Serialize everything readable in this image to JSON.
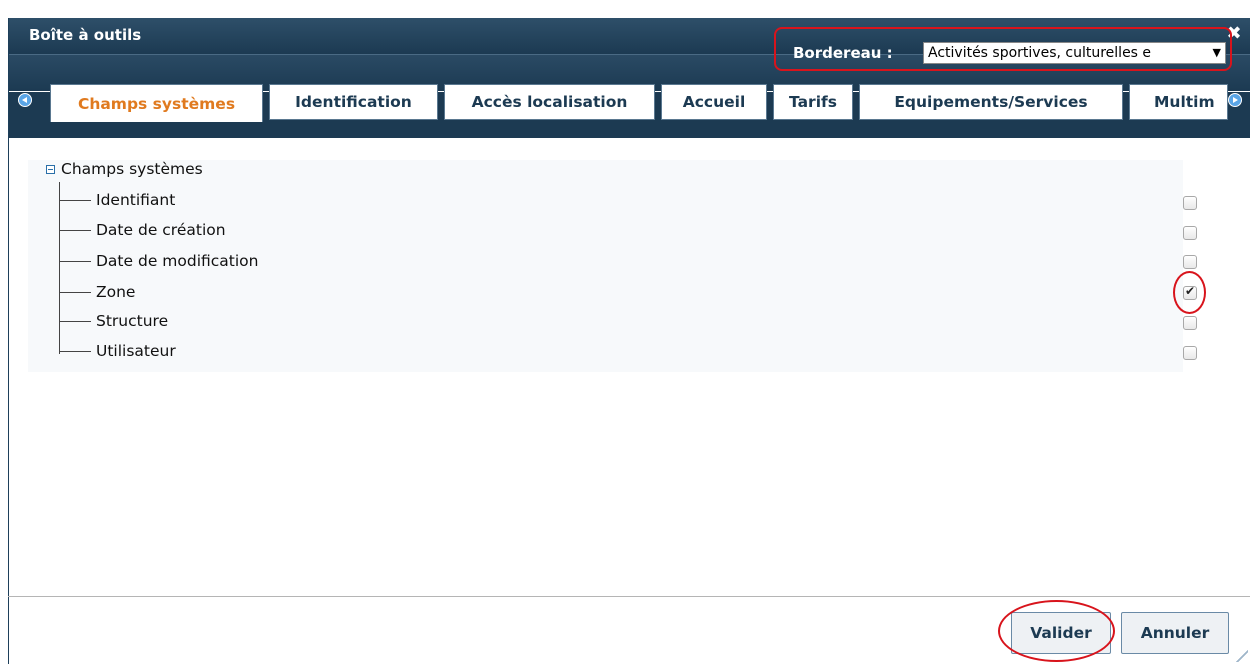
{
  "window": {
    "title": "Boîte à outils",
    "close_icon": "close-icon"
  },
  "toolbar": {
    "bordereau_label": "Bordereau :",
    "bordereau_selected": "Activités sportives, culturelles e"
  },
  "tabs": [
    {
      "label": "Champs systèmes",
      "active": true
    },
    {
      "label": "Identification",
      "active": false
    },
    {
      "label": "Accès localisation",
      "active": false
    },
    {
      "label": "Accueil",
      "active": false
    },
    {
      "label": "Tarifs",
      "active": false
    },
    {
      "label": "Equipements/Services",
      "active": false
    },
    {
      "label": "Multim",
      "active": false
    }
  ],
  "tree": {
    "root_label": "Champs systèmes",
    "items": [
      {
        "label": "Identifiant",
        "checked": false
      },
      {
        "label": "Date de création",
        "checked": false
      },
      {
        "label": "Date de modification",
        "checked": false
      },
      {
        "label": "Zone",
        "checked": true
      },
      {
        "label": "Structure",
        "checked": false
      },
      {
        "label": "Utilisateur",
        "checked": false
      }
    ]
  },
  "footer": {
    "valider_label": "Valider",
    "annuler_label": "Annuler"
  },
  "colors": {
    "header_bg": "#1c3a52",
    "active_tab_text": "#e07a1f",
    "highlight": "#d8141c"
  }
}
